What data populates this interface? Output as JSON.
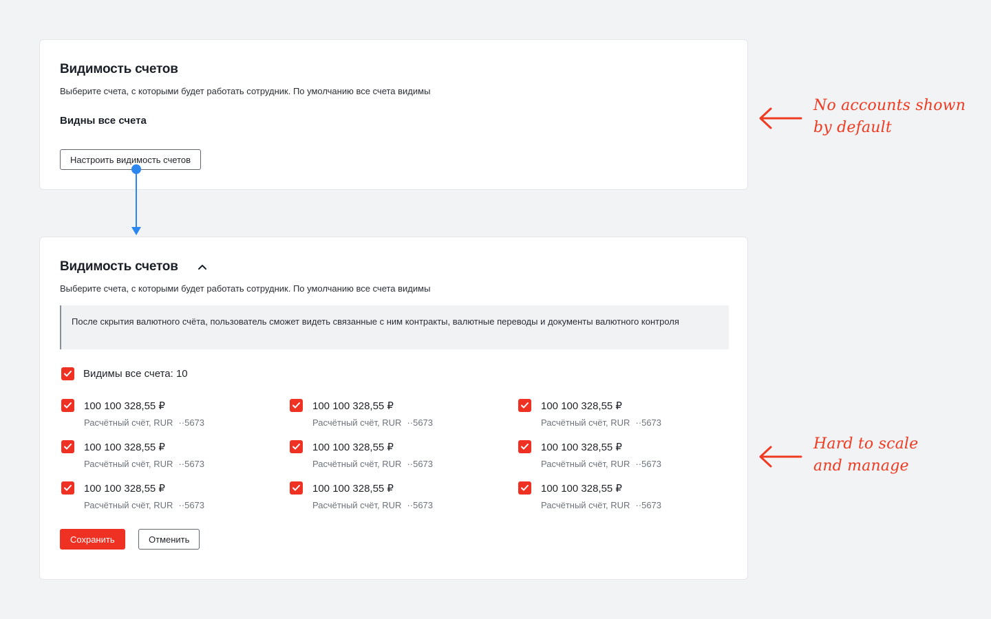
{
  "card_collapsed": {
    "title": "Видимость счетов",
    "description": "Выберите счета, с которыми будет работать сотрудник. По умолчанию все счета видимы",
    "status": "Видны все счета",
    "configure_button": "Настроить видимость счетов"
  },
  "card_expanded": {
    "title": "Видимость счетов",
    "description": "Выберите счета, с которыми будет работать сотрудник. По умолчанию все счета видимы",
    "notice": "После скрытия валютного счёта, пользователь сможет видеть связанные с ним контракты, валютные переводы и документы валютного контроля",
    "select_all": {
      "label": "Видимы все счета: 10",
      "checked": true
    },
    "accounts": [
      {
        "amount": "100 100 328,55 ₽",
        "type": "Расчётный счёт, RUR",
        "number": "··5673",
        "checked": true
      },
      {
        "amount": "100 100 328,55 ₽",
        "type": "Расчётный счёт, RUR",
        "number": "··5673",
        "checked": true
      },
      {
        "amount": "100 100 328,55 ₽",
        "type": "Расчётный счёт, RUR",
        "number": "··5673",
        "checked": true
      },
      {
        "amount": "100 100 328,55 ₽",
        "type": "Расчётный счёт, RUR",
        "number": "··5673",
        "checked": true
      },
      {
        "amount": "100 100 328,55 ₽",
        "type": "Расчётный счёт, RUR",
        "number": "··5673",
        "checked": true
      },
      {
        "amount": "100 100 328,55 ₽",
        "type": "Расчётный счёт, RUR",
        "number": "··5673",
        "checked": true
      },
      {
        "amount": "100 100 328,55 ₽",
        "type": "Расчётный счёт, RUR",
        "number": "··5673",
        "checked": true
      },
      {
        "amount": "100 100 328,55 ₽",
        "type": "Расчётный счёт, RUR",
        "number": "··5673",
        "checked": true
      },
      {
        "amount": "100 100 328,55 ₽",
        "type": "Расчётный счёт, RUR",
        "number": "··5673",
        "checked": true
      }
    ],
    "save_button": "Сохранить",
    "cancel_button": "Отменить"
  },
  "annotations": {
    "top": {
      "line1": "No accounts shown",
      "line2": "by default"
    },
    "bottom": {
      "line1": "Hard to scale",
      "line2": "and manage"
    }
  },
  "colors": {
    "accent_red": "#ef3124",
    "annotation_red": "#ef3b22",
    "connector_blue": "#2b86f0",
    "background": "#f2f3f5"
  },
  "icons": {
    "chevron": "chevron-up-icon",
    "checkbox_mark": "checkmark-icon",
    "annotation_arrow": "arrow-left-icon",
    "connector": "arrow-down-icon"
  }
}
